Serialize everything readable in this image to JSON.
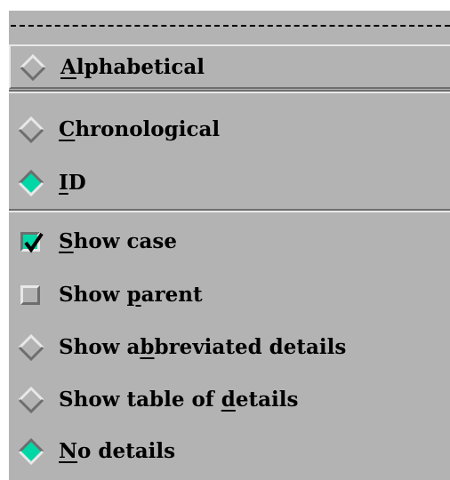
{
  "menu": {
    "sort_items": [
      {
        "pre": "",
        "u": "A",
        "post": "lphabetical",
        "selected": false
      },
      {
        "pre": "",
        "u": "C",
        "post": "hronological",
        "selected": false
      },
      {
        "pre": "",
        "u": "I",
        "post": "D",
        "selected": true
      }
    ],
    "show_items": [
      {
        "pre": "",
        "u": "S",
        "post": "how case",
        "checked": true
      },
      {
        "pre": "Show ",
        "u": "p",
        "post": "arent",
        "checked": false
      }
    ],
    "detail_items": [
      {
        "pre": "Show a",
        "u": "b",
        "post": "breviated details",
        "selected": false
      },
      {
        "pre": "Show table of ",
        "u": "d",
        "post": "etails",
        "selected": false
      },
      {
        "pre": "",
        "u": "N",
        "post": "o details",
        "selected": true
      }
    ]
  },
  "colors": {
    "menu_bg": "#b3b3b3",
    "indicator_on": "#00d7a6",
    "shadow_dark": "#6e6e6e",
    "shadow_light": "#e8e8e8"
  }
}
